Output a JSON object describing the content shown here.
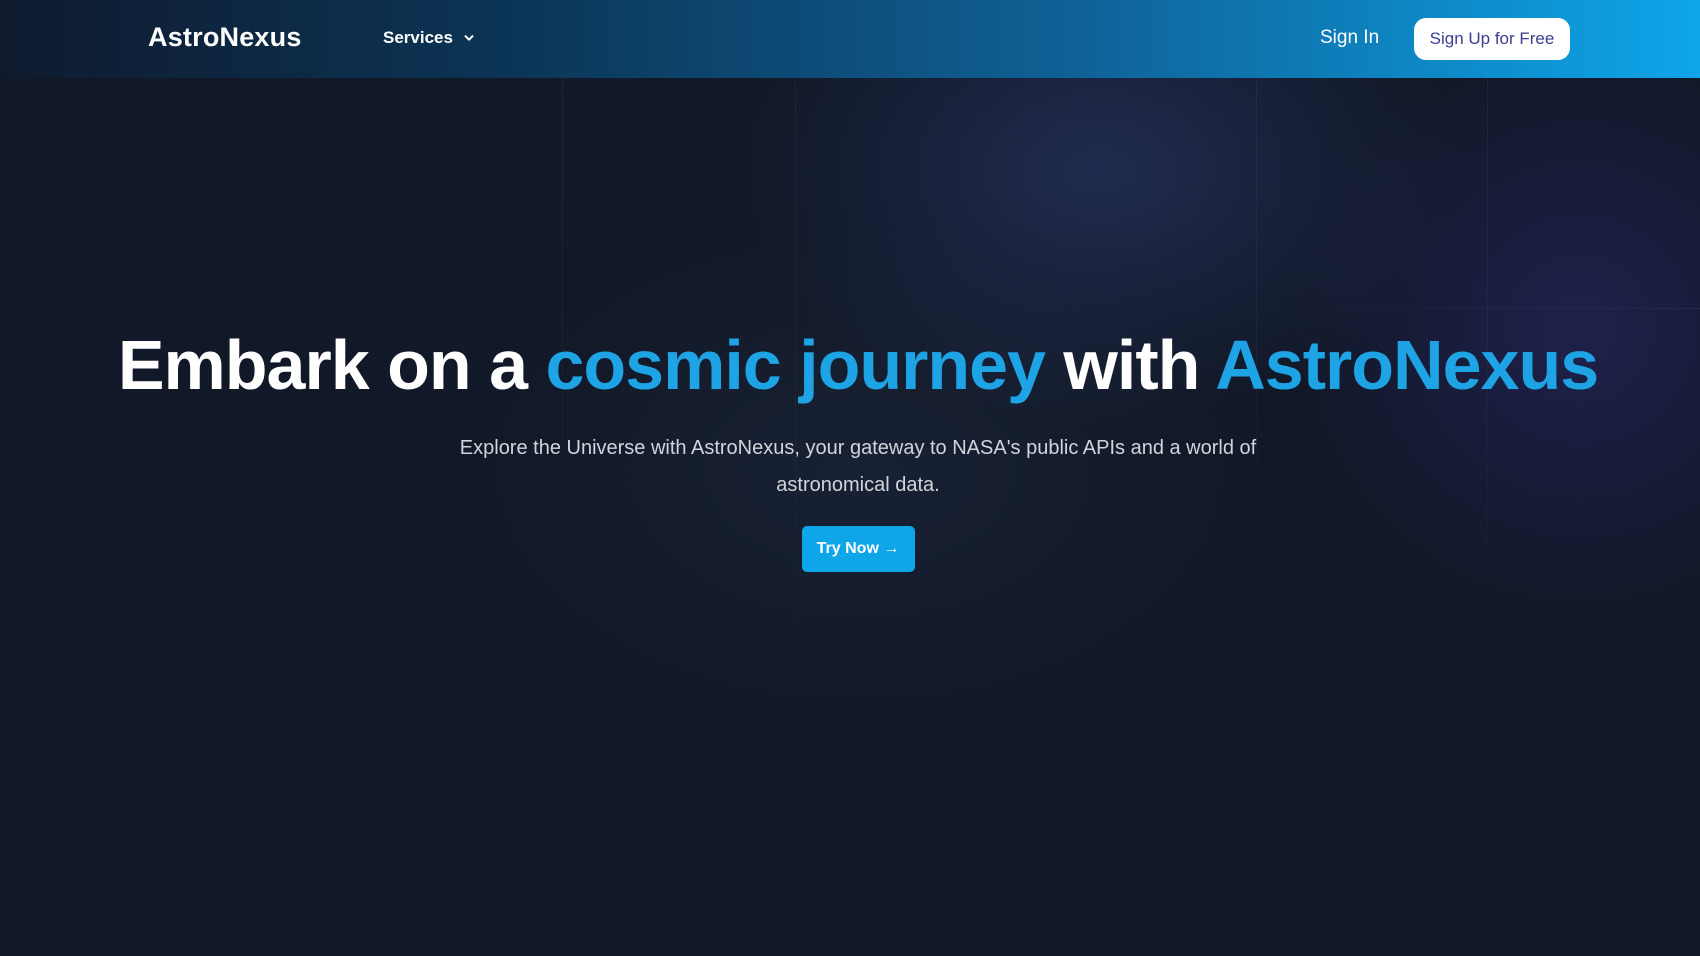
{
  "nav": {
    "logo": "AstroNexus",
    "services_label": "Services",
    "signin_label": "Sign In",
    "signup_label": "Sign Up for Free"
  },
  "hero": {
    "title_part1": "Embark on a ",
    "title_accent1": "cosmic journey",
    "title_part2": " with ",
    "title_accent2": "AstroNexus",
    "subtitle": "Explore the Universe with AstroNexus, your gateway to NASA's public APIs and a world of astronomical data.",
    "cta_label": "Try Now →"
  },
  "colors": {
    "background": "#111827",
    "accent": "#1ea3e4",
    "nav_gradient_end": "#0ea5e9",
    "signup_text": "#3b3f8f",
    "cta": "#0ea5e9"
  },
  "icons": {
    "services_dropdown": "chevron-down-icon"
  }
}
